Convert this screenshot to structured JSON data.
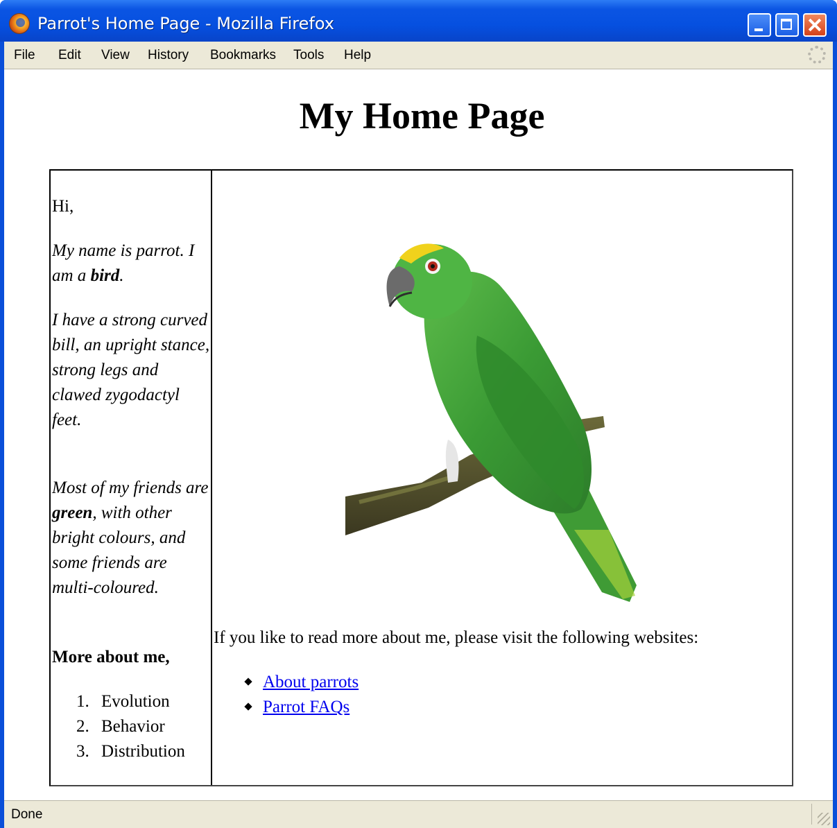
{
  "window": {
    "title": "Parrot's Home Page - Mozilla Firefox",
    "icon": "firefox-icon",
    "controls": [
      "minimize-icon",
      "maximize-icon",
      "close-icon"
    ]
  },
  "menu": {
    "items": [
      {
        "label": "File"
      },
      {
        "label": "Edit"
      },
      {
        "label": "View"
      },
      {
        "label": "History"
      },
      {
        "label": "Bookmarks"
      },
      {
        "label": "Tools"
      },
      {
        "label": "Help"
      }
    ]
  },
  "page": {
    "heading": "My Home Page",
    "left": {
      "greeting": "Hi,",
      "name_line": "My name is parrot. I am a ",
      "name_bold": "bird",
      "name_end": ".",
      "description": "I have a strong curved bill, an upright stance, strong legs and clawed zygodactyl feet.",
      "friends_start": "Most of my friends are ",
      "friends_bold": "green",
      "friends_end": ", with other bright colours, and some friends are multi-coloured.",
      "more_heading": "More about me,",
      "more_items": [
        {
          "num": "1.",
          "label": "Evolution"
        },
        {
          "num": "2.",
          "label": "Behavior"
        },
        {
          "num": "3.",
          "label": "Distribution"
        }
      ]
    },
    "right": {
      "image": "parrot-image",
      "visit_text": "If you like to read more about me, please visit the following websites:",
      "links": [
        {
          "label": "About parrots"
        },
        {
          "label": "Parrot FAQs"
        }
      ]
    }
  },
  "status": {
    "text": "Done"
  },
  "colors": {
    "title_bar": "#0650e0",
    "chrome": "#ece9d8",
    "link": "#0000ee",
    "parrot_green": "#3fa33a",
    "parrot_yellow": "#f0d21c"
  }
}
